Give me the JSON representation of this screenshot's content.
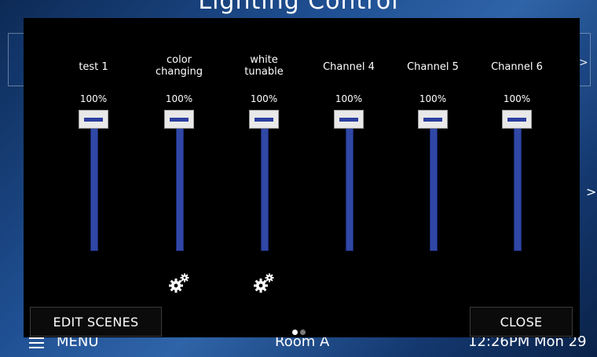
{
  "background": {
    "title": "Lighting Control",
    "bottom_bar": {
      "menu_label": "MENU",
      "room_label": "Room A",
      "time_label": "12:26PM  Mon 29"
    }
  },
  "popup": {
    "channels": [
      {
        "label": "test 1",
        "level": "100%",
        "has_settings": false
      },
      {
        "label": "color\nchanging",
        "level": "100%",
        "has_settings": true
      },
      {
        "label": "white\ntunable",
        "level": "100%",
        "has_settings": true
      },
      {
        "label": "Channel 4",
        "level": "100%",
        "has_settings": false
      },
      {
        "label": "Channel 5",
        "level": "100%",
        "has_settings": false
      },
      {
        "label": "Channel 6",
        "level": "100%",
        "has_settings": false
      }
    ],
    "next_page_icon": "chevron-right-icon",
    "pagination": {
      "pages": 2,
      "current": 1
    },
    "buttons": {
      "edit_scenes": "EDIT SCENES",
      "close": "CLOSE"
    }
  },
  "colors": {
    "popup_bg": "#000000",
    "slider_track": "#3047a6",
    "slider_handle": "#e9e9e9",
    "handle_indicator": "#2d3fa0"
  }
}
